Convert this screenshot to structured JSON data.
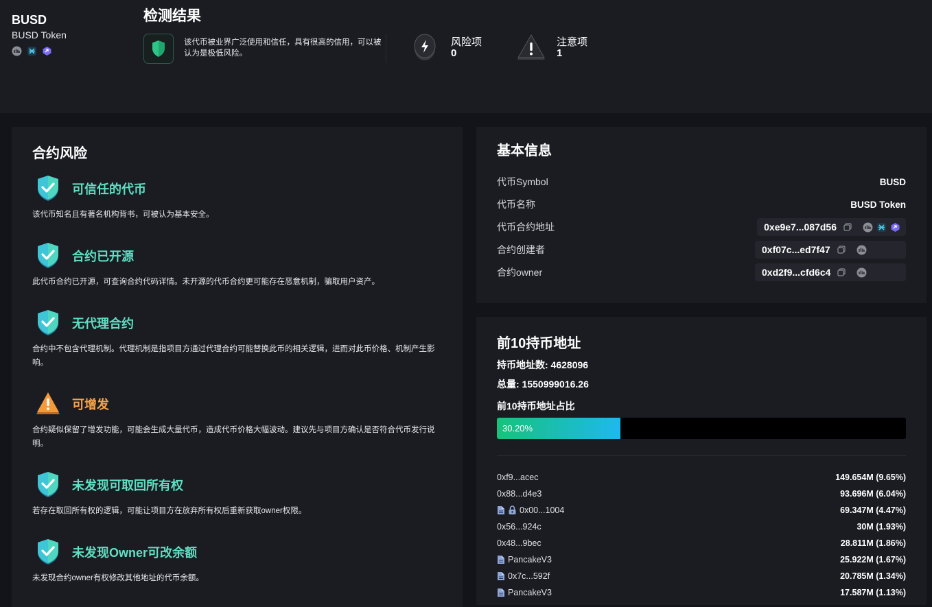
{
  "token": {
    "symbol": "BUSD",
    "name": "BUSD Token",
    "icons": [
      "bscscan-icon",
      "chain-explorer-icon",
      "analytics-icon"
    ]
  },
  "result": {
    "title": "检测结果",
    "description": "该代币被业界广泛使用和信任，具有很高的信用，可以被认为是极低风险。",
    "risk_label": "风险项",
    "risk_count": "0",
    "warn_label": "注意项",
    "warn_count": "1"
  },
  "contract_risk": {
    "title": "合约风险",
    "items": [
      {
        "title": "可信任的代币",
        "desc": "该代币知名且有著名机构背书，可被认为基本安全。",
        "status": "safe"
      },
      {
        "title": "合约已开源",
        "desc": "此代币合约已开源，可查询合约代码详情。未开源的代币合约更可能存在恶意机制，骗取用户资产。",
        "status": "safe"
      },
      {
        "title": "无代理合约",
        "desc": "合约中不包含代理机制。代理机制是指项目方通过代理合约可能替换此币的相关逻辑，进而对此币价格、机制产生影响。",
        "status": "safe"
      },
      {
        "title": "可增发",
        "desc": "合约疑似保留了增发功能，可能会生成大量代币，造成代币价格大幅波动。建议先与项目方确认是否符合代币发行说明。",
        "status": "warning"
      },
      {
        "title": "未发现可取回所有权",
        "desc": "若存在取回所有权的逻辑，可能让项目方在放弃所有权后重新获取owner权限。",
        "status": "safe"
      },
      {
        "title": "未发现Owner可改余额",
        "desc": "未发现合约owner有权修改其他地址的代币余额。",
        "status": "safe"
      }
    ]
  },
  "basic_info": {
    "title": "基本信息",
    "symbol_label": "代币Symbol",
    "symbol_value": "BUSD",
    "name_label": "代币名称",
    "name_value": "BUSD Token",
    "address_label": "代币合约地址",
    "address_value": "0xe9e7...087d56",
    "creator_label": "合约创建者",
    "creator_value": "0xf07c...ed7f47",
    "owner_label": "合约owner",
    "owner_value": "0xd2f9...cfd6c4"
  },
  "holders": {
    "title": "前10持币地址",
    "count_label": "持币地址数: 4628096",
    "total_label": "总量: 1550999016.26",
    "share_label": "前10持币地址占比",
    "share_percent": "30.20%",
    "share_value": 30.2,
    "rows": [
      {
        "addr": "0xf9...acec",
        "amount": "149.654M  (9.65%)",
        "icons": []
      },
      {
        "addr": "0x88...d4e3",
        "amount": "93.696M  (6.04%)",
        "icons": []
      },
      {
        "addr": "0x00...1004",
        "amount": "69.347M  (4.47%)",
        "icons": [
          "contract-file-icon",
          "lock-icon"
        ]
      },
      {
        "addr": "0x56...924c",
        "amount": "30M  (1.93%)",
        "icons": []
      },
      {
        "addr": "0x48...9bec",
        "amount": "28.811M  (1.86%)",
        "icons": []
      },
      {
        "addr": "PancakeV3",
        "amount": "25.922M  (1.67%)",
        "icons": [
          "contract-file-icon"
        ]
      },
      {
        "addr": "0x7c...592f",
        "amount": "20.785M  (1.34%)",
        "icons": [
          "contract-file-icon"
        ]
      },
      {
        "addr": "PancakeV3",
        "amount": "17.587M  (1.13%)",
        "icons": [
          "contract-file-icon"
        ]
      }
    ]
  },
  "colors": {
    "safe": "#5ee0c3",
    "warning": "#f5a347",
    "bar_start": "#17c27a",
    "bar_end": "#1fb8f0"
  }
}
